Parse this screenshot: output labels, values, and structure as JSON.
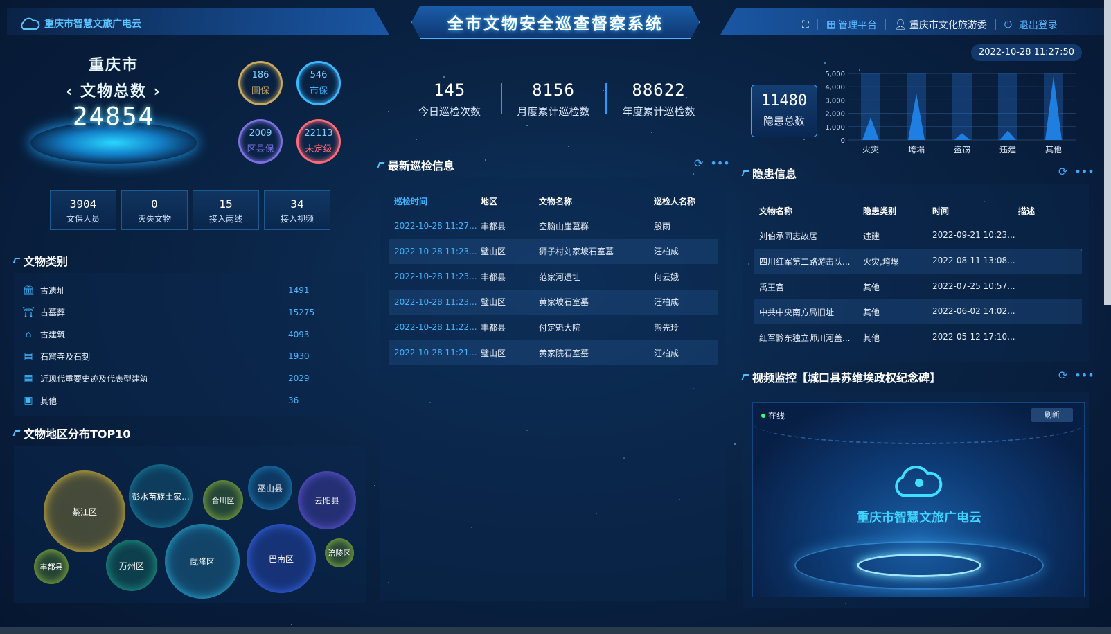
{
  "header": {
    "brand": "重庆市智慧文旅广电云",
    "title": "全市文物安全巡查督察系统",
    "nav_fullscreen_icon": "fullscreen-icon",
    "nav_manage": "管理平台",
    "nav_user": "重庆市文化旅游委",
    "nav_logout": "退出登录"
  },
  "datetime": "2022-10-28 11:27:50",
  "relics_total": {
    "city": "重庆市",
    "label": "文物总数",
    "value": "24854"
  },
  "rings": [
    {
      "value": "186",
      "label": "国保",
      "color": "#c9a860"
    },
    {
      "value": "546",
      "label": "市保",
      "color": "#3bb8ff"
    },
    {
      "value": "2009",
      "label": "区县保",
      "color": "#7b70e0"
    },
    {
      "value": "22113",
      "label": "未定级",
      "color": "#ff6a7a"
    }
  ],
  "stats_left": [
    {
      "value": "3904",
      "label": "文保人员"
    },
    {
      "value": "0",
      "label": "灭失文物"
    },
    {
      "value": "15",
      "label": "接入两线"
    },
    {
      "value": "34",
      "label": "接入视频"
    }
  ],
  "categories": {
    "title": "文物类别",
    "items": [
      {
        "name": "古遗址",
        "count": "1491",
        "icon": "temple-icon"
      },
      {
        "name": "古墓葬",
        "count": "15275",
        "icon": "tomb-icon"
      },
      {
        "name": "古建筑",
        "count": "4093",
        "icon": "pavilion-icon"
      },
      {
        "name": "石窟寺及石刻",
        "count": "1930",
        "icon": "grotto-icon"
      },
      {
        "name": "近现代重要史迹及代表型建筑",
        "count": "2029",
        "icon": "building-icon"
      },
      {
        "name": "其他",
        "count": "36",
        "icon": "other-icon"
      }
    ]
  },
  "distribution": {
    "title": "文物地区分布TOP10",
    "bubbles": [
      {
        "name": "綦江区"
      },
      {
        "name": "彭水苗族土家..."
      },
      {
        "name": "合川区"
      },
      {
        "name": "巫山县"
      },
      {
        "name": "云阳县"
      },
      {
        "name": "丰都县"
      },
      {
        "name": "万州区"
      },
      {
        "name": "武隆区"
      },
      {
        "name": "巴南区"
      },
      {
        "name": "涪陵区"
      }
    ]
  },
  "patrol_stats": [
    {
      "value": "145",
      "label": "今日巡检次数"
    },
    {
      "value": "8156",
      "label": "月度累计巡检数"
    },
    {
      "value": "88622",
      "label": "年度累计巡检数"
    }
  ],
  "patrol_info": {
    "title": "最新巡检信息",
    "columns": [
      "巡检时间",
      "地区",
      "文物名称",
      "巡检人名称"
    ],
    "rows": [
      [
        "2022-10-28 11:27...",
        "丰都县",
        "空脑山崖墓群",
        "殷雨"
      ],
      [
        "2022-10-28 11:23...",
        "璧山区",
        "狮子村刘家坡石室墓",
        "汪柏成"
      ],
      [
        "2022-10-28 11:23...",
        "丰都县",
        "范家河遗址",
        "何云娥"
      ],
      [
        "2022-10-28 11:23...",
        "璧山区",
        "黄家坡石室墓",
        "汪柏成"
      ],
      [
        "2022-10-28 11:22...",
        "丰都县",
        "付定魁大院",
        "熊先玲"
      ],
      [
        "2022-10-28 11:21...",
        "璧山区",
        "黄家院石室墓",
        "汪柏成"
      ]
    ]
  },
  "hazard_total": {
    "value": "11480",
    "label": "隐患总数"
  },
  "chart_data": {
    "type": "area",
    "categories": [
      "火灾",
      "垮塌",
      "盗窃",
      "违建",
      "其他"
    ],
    "values": [
      1700,
      3500,
      500,
      700,
      4800
    ],
    "yticks": [
      "5,000",
      "4,000",
      "3,000",
      "2,000",
      "1,000",
      "0"
    ],
    "ylim": [
      0,
      5000
    ],
    "grid": true
  },
  "hazard_info": {
    "title": "隐患信息",
    "columns": [
      "文物名称",
      "隐患类别",
      "时间",
      "描述"
    ],
    "rows": [
      [
        "刘伯承同志故居",
        "违建",
        "2022-09-21 10:23...",
        ""
      ],
      [
        "四川红军第二路游击队...",
        "火灾,垮塌",
        "2022-08-11 13:08...",
        ""
      ],
      [
        "禹王宫",
        "其他",
        "2022-07-25 10:57...",
        ""
      ],
      [
        "中共中央南方局旧址",
        "其他",
        "2022-06-02 14:02...",
        ""
      ],
      [
        "红军黔东独立师川河盖...",
        "其他",
        "2022-05-12 17:10...",
        ""
      ]
    ]
  },
  "video": {
    "title": "视频监控【城口县苏维埃政权纪念碑】",
    "status": "在线",
    "refresh": "刷新",
    "brand": "重庆市智慧文旅广电云"
  }
}
